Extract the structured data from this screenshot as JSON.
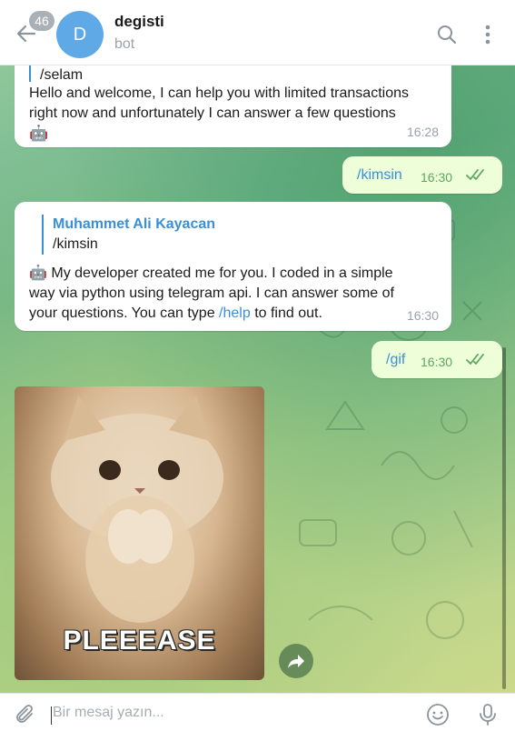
{
  "header": {
    "unread_count": "46",
    "avatar_letter": "D",
    "title": "degisti",
    "subtitle": "bot"
  },
  "messages": [
    {
      "direction": "in",
      "partial_top": "/selam",
      "text": "Hello and welcome, I can help you with limited transactions right now and unfortunately I can answer a few questions",
      "emoji": "🤖",
      "time": "16:28"
    },
    {
      "direction": "out",
      "text": "/kimsin",
      "time": "16:30",
      "status": "read"
    },
    {
      "direction": "in",
      "reply_name": "Muhammet Ali Kayacan",
      "reply_text": "/kimsin",
      "emoji": "🤖",
      "text_before_link": "My developer created me for you. I coded in a simple way via python using telegram api. I can answer some of your questions. You can type ",
      "link": "/help",
      "text_after_link": " to find out.",
      "time": "16:30"
    },
    {
      "direction": "out",
      "text": "/gif",
      "time": "16:30",
      "status": "read"
    },
    {
      "direction": "in",
      "type": "gif",
      "gif_caption": "PLEEEASE"
    }
  ],
  "composer": {
    "placeholder": "Bir mesaj yazın..."
  },
  "colors": {
    "accent": "#3a8fd6",
    "outgoing_bubble": "#eefed9",
    "check": "#5aa860"
  },
  "icons": [
    "back-arrow-icon",
    "search-icon",
    "more-vertical-icon",
    "robot-emoji-icon",
    "double-check-icon",
    "share-icon",
    "attach-icon",
    "emoji-icon",
    "mic-icon"
  ]
}
